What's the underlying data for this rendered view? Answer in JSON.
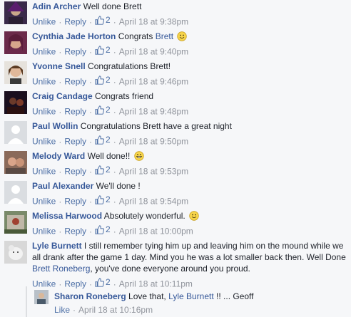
{
  "comments": [
    {
      "name": "Adin Archer",
      "text": "Well done Brett",
      "unlike": "Unlike",
      "reply": "Reply",
      "likes": "2",
      "time": "April 18 at 9:38pm"
    },
    {
      "name": "Cynthia Jade Horton",
      "text_before": "Congrats",
      "mention": "Brett",
      "unlike": "Unlike",
      "reply": "Reply",
      "likes": "2",
      "time": "April 18 at 9:40pm"
    },
    {
      "name": "Yvonne Snell",
      "text": "Congratulations Brett!",
      "unlike": "Unlike",
      "reply": "Reply",
      "likes": "2",
      "time": "April 18 at 9:46pm"
    },
    {
      "name": "Craig Candage",
      "text": "Congrats friend",
      "unlike": "Unlike",
      "reply": "Reply",
      "likes": "2",
      "time": "April 18 at 9:48pm"
    },
    {
      "name": "Paul Wollin",
      "text": "Congratulations Brett have a great night",
      "unlike": "Unlike",
      "reply": "Reply",
      "likes": "2",
      "time": "April 18 at 9:50pm"
    },
    {
      "name": "Melody Ward",
      "text": "Well done!!",
      "unlike": "Unlike",
      "reply": "Reply",
      "likes": "2",
      "time": "April 18 at 9:53pm"
    },
    {
      "name": "Paul Alexander",
      "text": "We'll done !",
      "unlike": "Unlike",
      "reply": "Reply",
      "likes": "2",
      "time": "April 18 at 9:54pm"
    },
    {
      "name": "Melissa Harwood",
      "text": "Absolutely wonderful.",
      "unlike": "Unlike",
      "reply": "Reply",
      "likes": "2",
      "time": "April 18 at 10:00pm"
    },
    {
      "name": "Lyle Burnett",
      "text_before": "I still remember tying him up and leaving him on the mound while we all drank after the game 1 day. Mind you he was a lot smaller back then. Well Done",
      "mention": "Brett Roneberg",
      "text_after": ", you've done everyone around you proud.",
      "unlike": "Unlike",
      "reply": "Reply",
      "likes": "2",
      "time": "April 18 at 10:11pm"
    }
  ],
  "reply": {
    "name": "Sharon Roneberg",
    "text_before": "Love that,",
    "mention": "Lyle Burnett",
    "text_after": "!! ... Geoff",
    "like": "Like",
    "time": "April 18 at 10:16pm"
  },
  "colors": {
    "link": "#365899",
    "meta": "#90949c",
    "background": "#f6f7f9"
  },
  "icons": {
    "like": "thumbs-up-icon",
    "smile": "smiley-emoji-icon",
    "grin": "grinning-emoji-icon"
  }
}
